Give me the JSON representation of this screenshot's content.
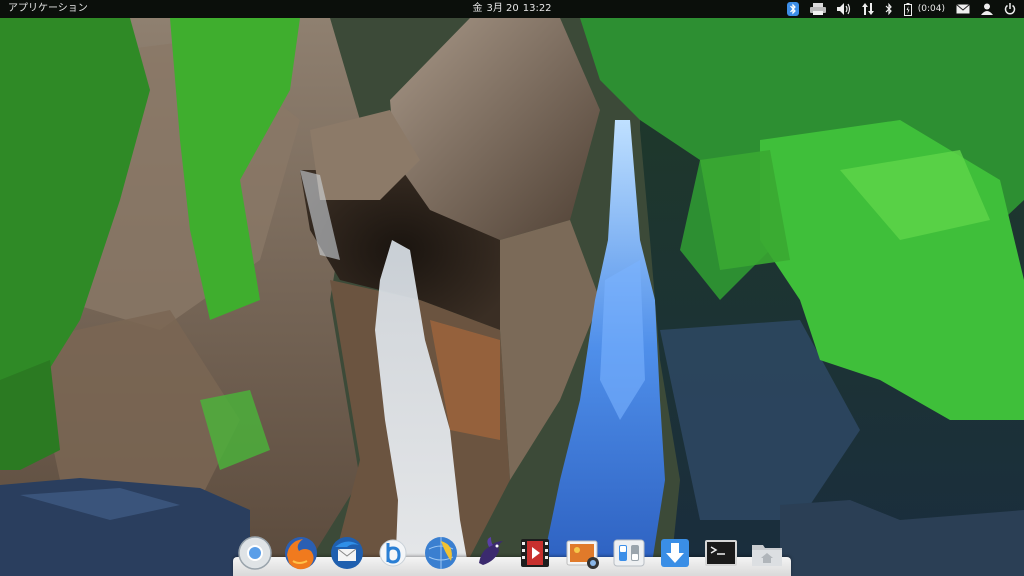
{
  "top_panel": {
    "apps_menu_label": "アプリケーション",
    "clock": {
      "day": "金",
      "date": "3月 20",
      "time": "13:22"
    },
    "indicators": {
      "battery_time": "(0:04)",
      "icons": [
        "bluetooth-active-icon",
        "printer-icon",
        "volume-icon",
        "network-transfer-icon",
        "bluetooth-icon",
        "battery-icon",
        "mail-icon",
        "user-icon",
        "power-icon"
      ]
    }
  },
  "dock": {
    "items": [
      {
        "name": "chrome",
        "icon": "chrome-icon"
      },
      {
        "name": "firefox",
        "icon": "firefox-icon"
      },
      {
        "name": "thunderbird",
        "icon": "thunderbird-icon"
      },
      {
        "name": "bookworm",
        "icon": "bookworm-icon"
      },
      {
        "name": "midori",
        "icon": "midori-icon"
      },
      {
        "name": "inkscape-bird",
        "icon": "bird-app-icon"
      },
      {
        "name": "video-player",
        "icon": "film-strip-icon"
      },
      {
        "name": "photos",
        "icon": "photo-viewer-icon"
      },
      {
        "name": "system-settings",
        "icon": "settings-switches-icon"
      },
      {
        "name": "software-center",
        "icon": "download-arrow-icon"
      },
      {
        "name": "terminal",
        "icon": "terminal-icon"
      },
      {
        "name": "files",
        "icon": "home-folder-icon"
      }
    ]
  },
  "colors": {
    "panel_bg": "#0a0c0a",
    "foliage": "#3fae2e",
    "water": "#3f7fe0",
    "rock": "#7b6a58"
  }
}
